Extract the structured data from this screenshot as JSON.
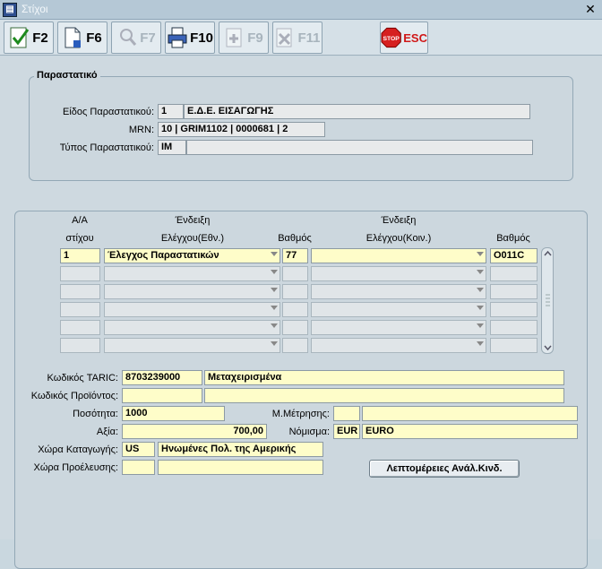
{
  "window": {
    "title": "Στίχοι",
    "close_glyph": "✕"
  },
  "toolbar": {
    "buttons": [
      {
        "label": "F2",
        "icon": "save-check-icon",
        "enabled": true
      },
      {
        "label": "F6",
        "icon": "new-document-icon",
        "enabled": true
      },
      {
        "label": "F7",
        "icon": "search-icon",
        "enabled": false
      },
      {
        "label": "F10",
        "icon": "printer-icon",
        "enabled": true
      },
      {
        "label": "F9",
        "icon": "add-record-icon",
        "enabled": false
      },
      {
        "label": "F11",
        "icon": "delete-record-icon",
        "enabled": false
      },
      {
        "label": "ESC",
        "icon": "stop-sign-icon",
        "enabled": true,
        "stop_text": "STOP"
      }
    ]
  },
  "document_section": {
    "legend": "Παραστατικό",
    "doc_type_label": "Είδος Παραστατικού:",
    "doc_type_code": "1",
    "doc_type_desc": "Ε.Δ.Ε. ΕΙΣΑΓΩΓΗΣ",
    "mrn_label": "MRN:",
    "mrn_value": "10 | GRIM1102 | 0000681 | 2",
    "form_type_label": "Τύπος Παραστατικού:",
    "form_type_code": "IM",
    "form_type_desc": ""
  },
  "lines_section": {
    "headers": {
      "aa_line1": "Α/Α",
      "aa_line2": "στίχου",
      "ind_nat_line1": "Ένδειξη",
      "ind_nat_line2": "Ελέγχου(Εθν.)",
      "grade1": "Βαθμός",
      "ind_com_line1": "Ένδειξη",
      "ind_com_line2": "Ελέγχου(Κοιν.)",
      "grade2": "Βαθμός"
    },
    "rows": [
      {
        "aa": "1",
        "ind_nat": "Έλεγχος Παραστατικών",
        "grade1": "77",
        "ind_com": "",
        "grade2": "O011C"
      },
      {
        "aa": "",
        "ind_nat": "",
        "grade1": "",
        "ind_com": "",
        "grade2": ""
      },
      {
        "aa": "",
        "ind_nat": "",
        "grade1": "",
        "ind_com": "",
        "grade2": ""
      },
      {
        "aa": "",
        "ind_nat": "",
        "grade1": "",
        "ind_com": "",
        "grade2": ""
      },
      {
        "aa": "",
        "ind_nat": "",
        "grade1": "",
        "ind_com": "",
        "grade2": ""
      },
      {
        "aa": "",
        "ind_nat": "",
        "grade1": "",
        "ind_com": "",
        "grade2": ""
      }
    ],
    "details": {
      "taric_label": "Κωδικός TARIC:",
      "taric_code": "8703239000",
      "taric_desc": "Μεταχειρισμένα",
      "product_label": "Κωδικός Προϊόντος:",
      "product_code": "",
      "product_desc": "",
      "quantity_label": "Ποσότητα:",
      "quantity": "1000",
      "unit_label": "Μ.Μέτρησης:",
      "unit_code": "",
      "unit_desc": "",
      "value_label": "Αξία:",
      "value": "700,00",
      "currency_label": "Νόμισμα:",
      "currency_code": "EUR",
      "currency_desc": "EURO",
      "origin_label": "Χώρα Καταγωγής:",
      "origin_code": "US",
      "origin_desc": "Ηνωμένες Πολ. της Αμερικής",
      "provenance_label": "Χώρα Προέλευσης:",
      "provenance_code": "",
      "provenance_desc": "",
      "details_button": "Λεπτομέρειες Ανάλ.Κινδ."
    }
  }
}
